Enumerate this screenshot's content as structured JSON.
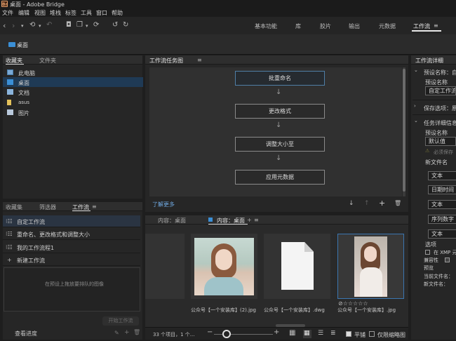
{
  "window": {
    "app_icon": "Br",
    "title": "桌面 - Adobe Bridge"
  },
  "menu": [
    "文件",
    "编辑",
    "视图",
    "堆栈",
    "标签",
    "工具",
    "窗口",
    "帮助"
  ],
  "toolbar": {
    "icons": [
      "back-icon",
      "forward-icon",
      "chevron-down-icon",
      "history-icon",
      "chevron-down-icon",
      "return-icon",
      "camera-icon",
      "copy-icon",
      "chevron-down-icon",
      "refresh-icon",
      "rotate-left-icon",
      "rotate-right-icon"
    ],
    "workspaces": [
      "基本功能",
      "库",
      "胶片",
      "输出",
      "元数据",
      "工作流"
    ],
    "active_workspace": "工作流",
    "menu_glyph": "≡"
  },
  "path": {
    "label": "桌面"
  },
  "left_top": {
    "tabs": [
      "收藏夹",
      "文件夹"
    ],
    "items": [
      {
        "label": "此电脑",
        "icon": "computer-icon",
        "selected": false
      },
      {
        "label": "桌面",
        "icon": "desktop-folder-icon",
        "selected": true
      },
      {
        "label": "文档",
        "icon": "documents-icon",
        "selected": false
      },
      {
        "label": "asus",
        "icon": "user-folder-icon",
        "selected": false
      },
      {
        "label": "图片",
        "icon": "pictures-icon",
        "selected": false
      }
    ]
  },
  "left_bottom": {
    "tabs": [
      "收藏集",
      "筛选器",
      "工作流"
    ],
    "workflows": [
      "自定工作流",
      "重命名、更改格式和调整大小",
      "我的工作流程1"
    ],
    "new_workflow": "新建工作流",
    "hint": "在预设上拖放要排队的图像",
    "start_button": "开始工作流",
    "view_progress": "查看进度"
  },
  "task_panel": {
    "title": "工作流任务图",
    "steps": [
      "批重命名",
      "更改格式",
      "调整大小至",
      "应用元数据"
    ],
    "learn_more": "了解更多"
  },
  "content": {
    "tabs": [
      "内容：桌面",
      "内容：桌面"
    ],
    "items": [
      {
        "label": "",
        "type": "partial"
      },
      {
        "label": "公众号【一个安装库】(2).jpg",
        "type": "photo"
      },
      {
        "label": "公众号【一个安装库】.dwg",
        "type": "document"
      },
      {
        "label": "公众号【一个安装库】.jpg",
        "type": "photo",
        "rating": "☆☆☆☆☆",
        "selected": true
      }
    ],
    "status": "33 个项目，1 个...",
    "tiling_label": "平铺",
    "thumbs_only_label": "仅限缩略图"
  },
  "inspector": {
    "title": "工作流详细",
    "preset_name_label": "预设名称：自",
    "preset_name_field_label": "预设名称",
    "preset_name_value": "自定工作流",
    "save_options_label": "保存选项：原",
    "task_details_label": "任务详细信息",
    "preset_label": "预设名称",
    "preset_value": "默认值",
    "warning_text": "必须保存",
    "new_filename_label": "新文件名",
    "fields": [
      "文本",
      "日期时间",
      "文本",
      "序列数字",
      "文本"
    ],
    "options_label": "选项",
    "xmp_label": "在 XMP 元",
    "compat_label": "兼容性",
    "preview_label": "预览",
    "current_filename_label": "当前文件名：",
    "new_filename_label2": "新文件名："
  }
}
